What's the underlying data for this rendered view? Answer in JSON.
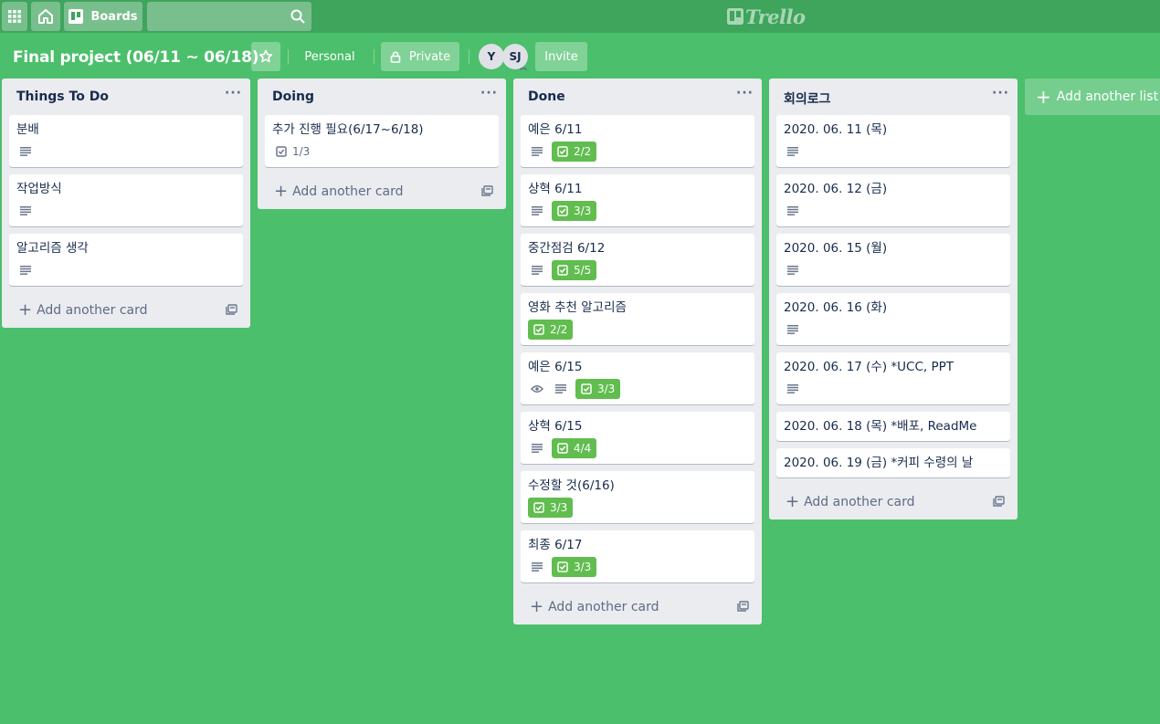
{
  "topbar": {
    "boards_label": "Boards",
    "logo_text": "Trello"
  },
  "board": {
    "title": "Final project (06/11 ~ 06/18)",
    "personal_label": "Personal",
    "private_label": "Private",
    "members": [
      "Y",
      "SJ"
    ],
    "invite_label": "Invite"
  },
  "add_card_label": "Add another card",
  "add_list_label": "Add another list",
  "colors": {
    "background": "#4bbf6b",
    "topbar": "#3fa45c",
    "checklist_complete": "#61bd4f",
    "list_bg": "#ebecf0"
  },
  "lists": [
    {
      "title": "Things To Do",
      "cards": [
        {
          "title": "분배",
          "description": true
        },
        {
          "title": "작업방식",
          "description": true
        },
        {
          "title": "알고리즘 생각",
          "description": true
        }
      ]
    },
    {
      "title": "Doing",
      "cards": [
        {
          "title": "추가 진행 필요(6/17~6/18)",
          "checklist": "1/3",
          "complete": false
        }
      ]
    },
    {
      "title": "Done",
      "cards": [
        {
          "title": "예은 6/11",
          "description": true,
          "checklist": "2/2",
          "complete": true
        },
        {
          "title": "상혁 6/11",
          "description": true,
          "checklist": "3/3",
          "complete": true
        },
        {
          "title": "중간점검 6/12",
          "description": true,
          "checklist": "5/5",
          "complete": true
        },
        {
          "title": "영화 추천 알고리즘",
          "checklist": "2/2",
          "complete": true
        },
        {
          "title": "예은 6/15",
          "watching": true,
          "description": true,
          "checklist": "3/3",
          "complete": true
        },
        {
          "title": "상혁 6/15",
          "description": true,
          "checklist": "4/4",
          "complete": true
        },
        {
          "title": "수정할 것(6/16)",
          "checklist": "3/3",
          "complete": true
        },
        {
          "title": "최종 6/17",
          "description": true,
          "checklist": "3/3",
          "complete": true
        }
      ]
    },
    {
      "title": "회의로그",
      "cards": [
        {
          "title": "2020. 06. 11 (목)",
          "description": true
        },
        {
          "title": "2020. 06. 12 (금)",
          "description": true
        },
        {
          "title": "2020. 06. 15 (월)",
          "description": true
        },
        {
          "title": "2020. 06. 16 (화)",
          "description": true
        },
        {
          "title": "2020. 06. 17 (수) *UCC, PPT",
          "description": true
        },
        {
          "title": "2020. 06. 18 (목) *배포, ReadMe"
        },
        {
          "title": "2020. 06. 19 (금) *커피 수령의 날"
        }
      ]
    }
  ]
}
